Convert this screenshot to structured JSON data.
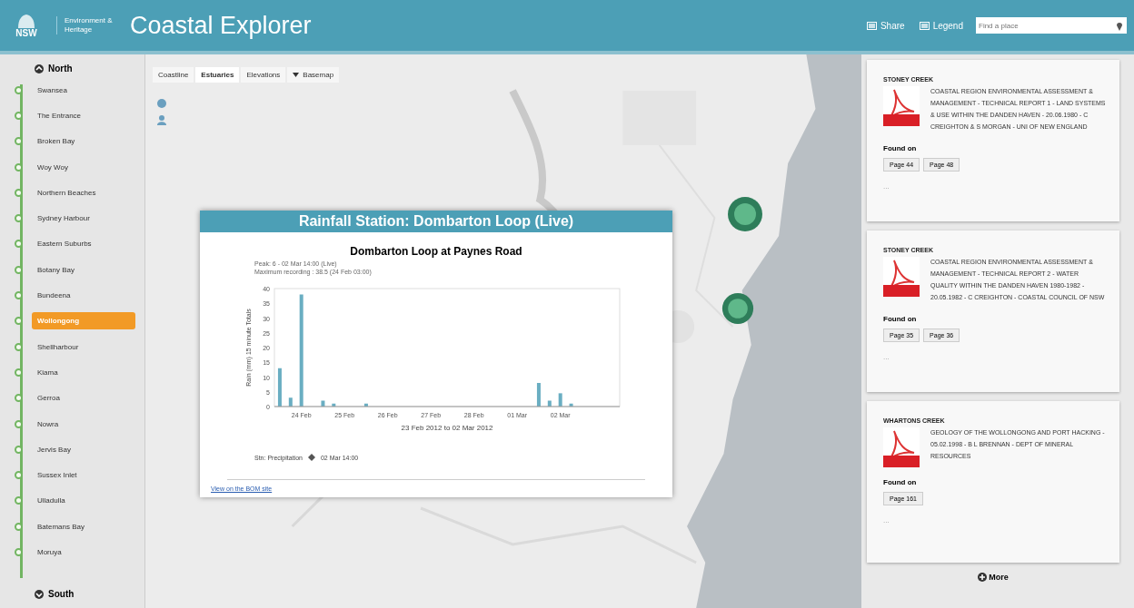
{
  "header": {
    "org": "NSW",
    "org_unit": "Environment & Heritage",
    "title": "Coastal Explorer",
    "actions": [
      "Share",
      "Legend"
    ],
    "search": {
      "placeholder": "Find a place"
    }
  },
  "sidebar": {
    "north": "North",
    "south": "South",
    "items": [
      {
        "label": "Swansea",
        "selected": false
      },
      {
        "label": "The Entrance",
        "selected": false
      },
      {
        "label": "Broken Bay",
        "selected": false
      },
      {
        "label": "Woy Woy",
        "selected": false
      },
      {
        "label": "Northern Beaches",
        "selected": false
      },
      {
        "label": "Sydney Harbour",
        "selected": false
      },
      {
        "label": "Eastern Suburbs",
        "selected": false
      },
      {
        "label": "Botany Bay",
        "selected": false
      },
      {
        "label": "Bundeena",
        "selected": false
      },
      {
        "label": "Wollongong",
        "selected": true
      },
      {
        "label": "Shellharbour",
        "selected": false
      },
      {
        "label": "Kiama",
        "selected": false
      },
      {
        "label": "Gerroa",
        "selected": false
      },
      {
        "label": "Nowra",
        "selected": false
      },
      {
        "label": "Jervis Bay",
        "selected": false
      },
      {
        "label": "Sussex Inlet",
        "selected": false
      },
      {
        "label": "Ulladulla",
        "selected": false
      },
      {
        "label": "Batemans Bay",
        "selected": false
      },
      {
        "label": "Moruya",
        "selected": false
      }
    ]
  },
  "map": {
    "kind": "picture",
    "layers": [
      {
        "label": "Coastline",
        "selected": false,
        "kind": "tab"
      },
      {
        "label": "Estuaries",
        "selected": true,
        "kind": "tab"
      },
      {
        "label": "Elevations",
        "selected": false,
        "kind": "tab"
      },
      {
        "label": "Basemap",
        "selected": false,
        "kind": "menu"
      }
    ]
  },
  "popup": {
    "title": "Rainfall Station: Dombarton Loop (Live)",
    "chart_title": "Dombarton Loop at Paynes Road",
    "info": [
      "Peak: 6 - 02 Mar 14:00 (Live)",
      "Maximum recording : 38.5 (24 Feb 03:00)"
    ],
    "legend": "Stn: Precipitation",
    "legend_time": "02 Mar 14:00",
    "link": "View on the BOM site",
    "chart_data": {
      "type": "bar",
      "xlabel": "23 Feb 2012 to 02 Mar 2012",
      "ylabel": "Rain (mm) 15 minute Totals",
      "categories": [
        null,
        null,
        "24 Feb",
        null,
        null,
        null,
        "25 Feb",
        null,
        null,
        null,
        "26 Feb",
        null,
        null,
        null,
        "27 Feb",
        null,
        null,
        null,
        "28 Feb",
        null,
        null,
        null,
        "01 Mar",
        null,
        null,
        null,
        "02 Mar",
        null,
        null,
        null,
        null,
        null
      ],
      "values": [
        13,
        3,
        38,
        null,
        2,
        1,
        null,
        null,
        1,
        null,
        null,
        null,
        null,
        null,
        null,
        null,
        null,
        null,
        null,
        null,
        null,
        null,
        null,
        null,
        8,
        2,
        4.5,
        1,
        null,
        null,
        null,
        null
      ],
      "color": "#6aaec2",
      "ylim": [
        0,
        40
      ],
      "yticks": [
        0,
        5,
        10,
        15,
        20,
        25,
        30,
        35,
        40
      ]
    }
  },
  "documents": [
    {
      "place": "STONEY CREEK",
      "title": "COASTAL REGION ENVIRONMENTAL ASSESSMENT & MANAGEMENT - TECHNICAL REPORT 1 - LAND SYSTEMS & USE WITHIN THE DANDEN HAVEN - 20.06.1980 - C CREIGHTON & S MORGAN - UNI OF NEW ENGLAND",
      "found_label": "Found on",
      "pages": [
        "Page 44",
        "Page 48"
      ],
      "more": "..."
    },
    {
      "place": "STONEY CREEK",
      "title": "COASTAL REGION ENVIRONMENTAL ASSESSMENT & MANAGEMENT - TECHNICAL REPORT 2 - WATER QUALITY WITHIN THE DANDEN HAVEN 1980-1982 - 20.05.1982 - C CREIGHTON - COASTAL COUNCIL OF NSW",
      "found_label": "Found on",
      "pages": [
        "Page 35",
        "Page 36"
      ],
      "more": "..."
    },
    {
      "place": "WHARTONS CREEK",
      "title": "GEOLOGY OF THE WOLLONGONG AND PORT HACKING - 05.02.1998 - B L BRENNAN - DEPT OF MINERAL RESOURCES",
      "found_label": "Found on",
      "pages": [
        "Page 161"
      ],
      "more": "..."
    }
  ],
  "more_button": "More"
}
